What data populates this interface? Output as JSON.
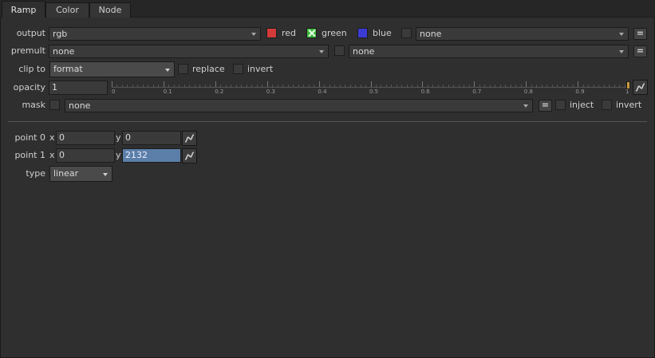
{
  "tabs": [
    "Ramp",
    "Color",
    "Node"
  ],
  "output": {
    "label": "output",
    "value": "rgb",
    "channels": [
      {
        "name": "red",
        "color": "#d33b3b",
        "checked": false
      },
      {
        "name": "green",
        "color": "#3db93d",
        "checked": true
      },
      {
        "name": "blue",
        "color": "#3b3bd3",
        "checked": false
      }
    ],
    "extra_value": "none",
    "eq_label": "="
  },
  "premult": {
    "label": "premult",
    "value": "none",
    "extra_value": "none",
    "eq_label": "="
  },
  "clip_to": {
    "label": "clip to",
    "value": "format",
    "replace_label": "replace",
    "invert_label": "invert"
  },
  "opacity": {
    "label": "opacity",
    "value": "1",
    "slider_ticks": [
      "0",
      "0.1",
      "0.2",
      "0.3",
      "0.4",
      "0.5",
      "0.6",
      "0.7",
      "0.8",
      "0.9",
      "1"
    ],
    "slider_value": 1.0
  },
  "mask": {
    "label": "mask",
    "value": "none",
    "eq_label": "=",
    "inject_label": "inject",
    "invert_label": "invert"
  },
  "point0": {
    "label": "point 0",
    "x_label": "x",
    "x": "0",
    "y_label": "y",
    "y": "0"
  },
  "point1": {
    "label": "point 1",
    "x_label": "x",
    "x": "0",
    "y_label": "y",
    "y": "2132"
  },
  "type": {
    "label": "type",
    "value": "linear"
  }
}
